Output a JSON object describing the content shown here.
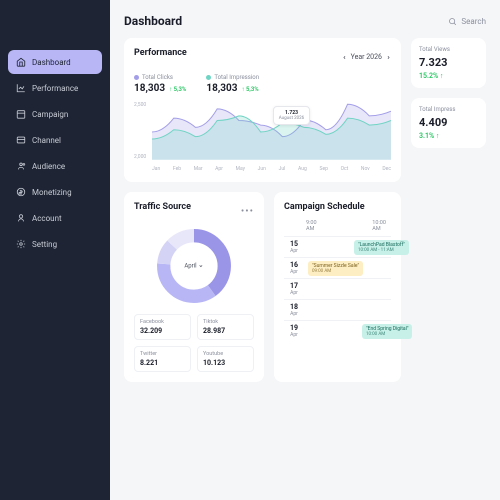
{
  "sidebar": {
    "items": [
      {
        "label": "Dashboard",
        "icon": "home",
        "active": true
      },
      {
        "label": "Performance",
        "icon": "chart",
        "active": false
      },
      {
        "label": "Campaign",
        "icon": "calendar",
        "active": false
      },
      {
        "label": "Channel",
        "icon": "layers",
        "active": false
      },
      {
        "label": "Audience",
        "icon": "users",
        "active": false
      },
      {
        "label": "Monetizing",
        "icon": "dollar",
        "active": false
      },
      {
        "label": "Account",
        "icon": "user",
        "active": false
      },
      {
        "label": "Setting",
        "icon": "gear",
        "active": false
      }
    ]
  },
  "header": {
    "title": "Dashboard",
    "search_placeholder": "Search"
  },
  "performance": {
    "title": "Performance",
    "year_label": "Year 2026",
    "metrics": [
      {
        "label": "Total Clicks",
        "value": "18,303",
        "change": "5,3%"
      },
      {
        "label": "Total Impression",
        "value": "18,303",
        "change": "5,3%"
      }
    ],
    "tooltip": {
      "value": "1.723",
      "date": "August 2026"
    }
  },
  "chart_data": {
    "type": "area",
    "categories": [
      "Jan",
      "Feb",
      "Mar",
      "Apr",
      "May",
      "Jun",
      "Jul",
      "Aug",
      "Sep",
      "Oct",
      "Nov",
      "Dec"
    ],
    "series": [
      {
        "name": "Total Clicks",
        "color": "#a39ee8",
        "values": [
          1200,
          1800,
          1400,
          2200,
          1700,
          1500,
          1000,
          1723,
          1300,
          2400,
          1900,
          2100
        ]
      },
      {
        "name": "Total Impression",
        "color": "#6fd4c4",
        "values": [
          900,
          1300,
          1000,
          1700,
          1900,
          1200,
          1600,
          1400,
          1100,
          1800,
          1500,
          1700
        ]
      }
    ],
    "ylim": [
      0,
      2500
    ],
    "y_ticks": [
      2500,
      2000
    ],
    "xlabel": "",
    "ylabel": ""
  },
  "stats": [
    {
      "label": "Total Views",
      "value": "7.323",
      "change": "15.2%"
    },
    {
      "label": "Total Impress",
      "value": "4.409",
      "change": "3.1%"
    }
  ],
  "traffic": {
    "title": "Traffic Source",
    "month": "April",
    "sources": [
      {
        "name": "Facebook",
        "value": "32.209"
      },
      {
        "name": "Tiktok",
        "value": "28.987"
      },
      {
        "name": "Twitter",
        "value": "8.221"
      },
      {
        "name": "Youtube",
        "value": "10.123"
      }
    ],
    "donut": [
      {
        "color": "#9b95e8",
        "pct": 40
      },
      {
        "color": "#b8b6f5",
        "pct": 36
      },
      {
        "color": "#d4d3f5",
        "pct": 11
      },
      {
        "color": "#e8e7f9",
        "pct": 13
      }
    ]
  },
  "schedule": {
    "title": "Campaign Schedule",
    "times": [
      "9:00 AM",
      "10:00 AM"
    ],
    "rows": [
      {
        "day": "15",
        "mon": "Apr",
        "events": [
          {
            "title": "\"LaunchPad Blastoff\"",
            "time": "10:00 AM - 11:AM",
            "color": "teal",
            "left": 70
          }
        ]
      },
      {
        "day": "16",
        "mon": "Apr",
        "events": [
          {
            "title": "\"Summer Sizzle Sale\"",
            "time": "09:00 AM",
            "color": "yellow",
            "left": 24
          }
        ]
      },
      {
        "day": "17",
        "mon": "Apr",
        "events": []
      },
      {
        "day": "18",
        "mon": "Apr",
        "events": []
      },
      {
        "day": "19",
        "mon": "Apr",
        "events": [
          {
            "title": "\"End Spring Digital\"",
            "time": "10:00 AM",
            "color": "teal",
            "left": 78
          }
        ]
      }
    ]
  }
}
